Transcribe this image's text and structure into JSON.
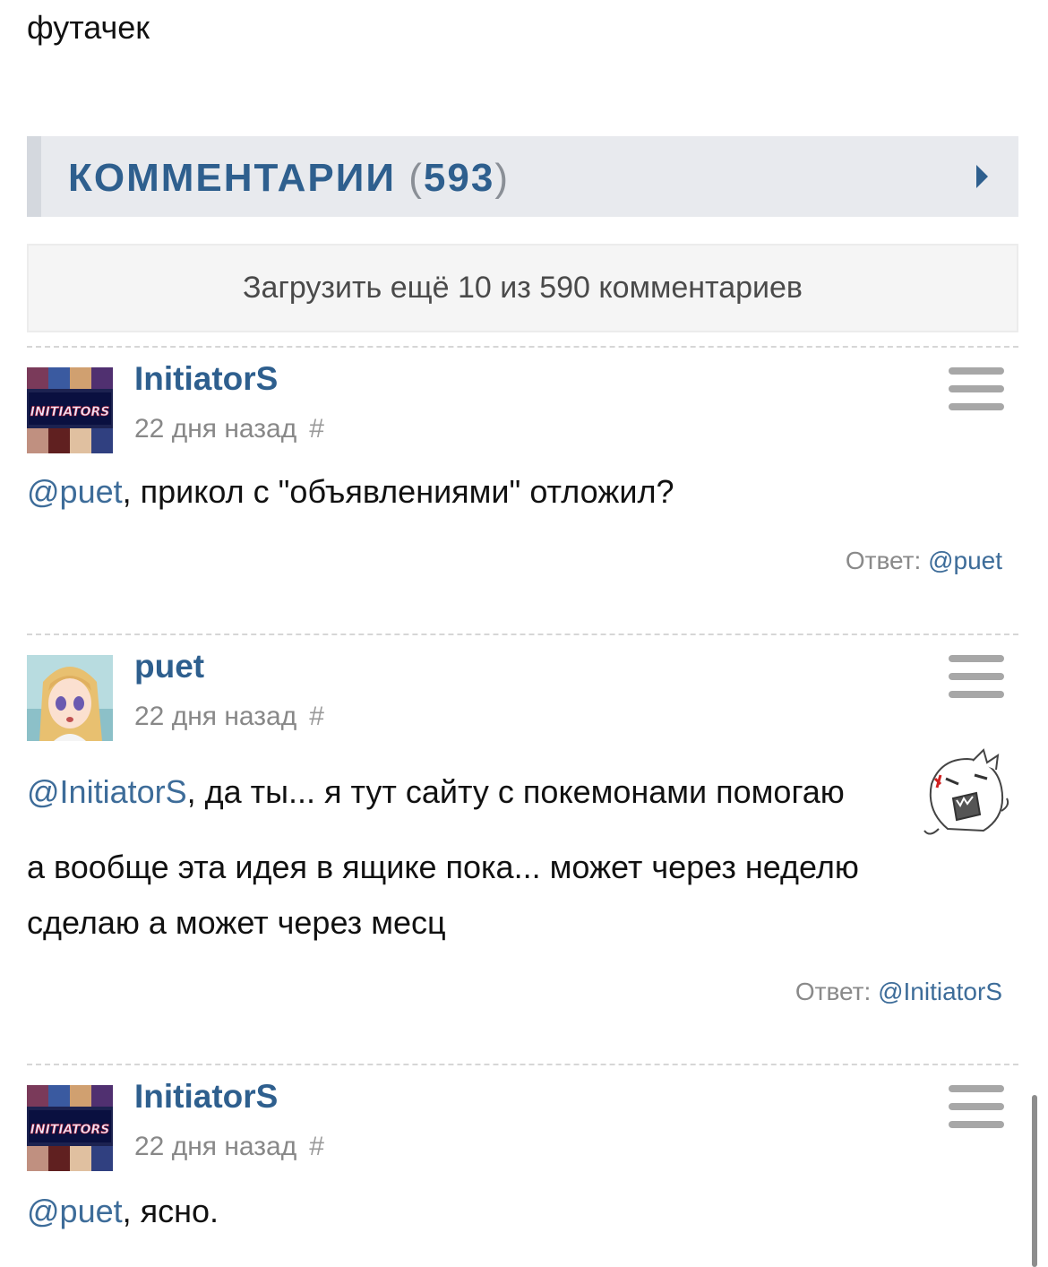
{
  "top_text": "футачек",
  "comments_section": {
    "title": "КОММЕНТАРИИ",
    "open_paren": "(",
    "count": "593",
    "close_paren": ")",
    "load_more": "Загрузить ещё 10 из 590 комментариев"
  },
  "comments": [
    {
      "author": "InitiatorS",
      "time": "22 дня назад",
      "anchor": "#",
      "mention": "@puet",
      "text": ", прикол с \"объявлениями\" отложил?",
      "reply_label": "Ответ:",
      "reply_to": "@puet"
    },
    {
      "author": "puet",
      "time": "22 дня назад",
      "anchor": "#",
      "mention": "@InitiatorS",
      "text": ", да ты... я тут сайту с покемонами помогаю",
      "text_line2": "а вообще эта идея в ящике пока... может через неделю",
      "text_line3": "сделаю а может через месц",
      "reply_label": "Ответ:",
      "reply_to": "@InitiatorS"
    },
    {
      "author": "InitiatorS",
      "time": "22 дня назад",
      "anchor": "#",
      "mention": "@puet",
      "text": ", ясно."
    }
  ],
  "avatar_logo_text": "INITIATORS",
  "colors": {
    "accent": "#2e5f8e",
    "link": "#3d6c99",
    "header_bg": "#e8eaee"
  }
}
